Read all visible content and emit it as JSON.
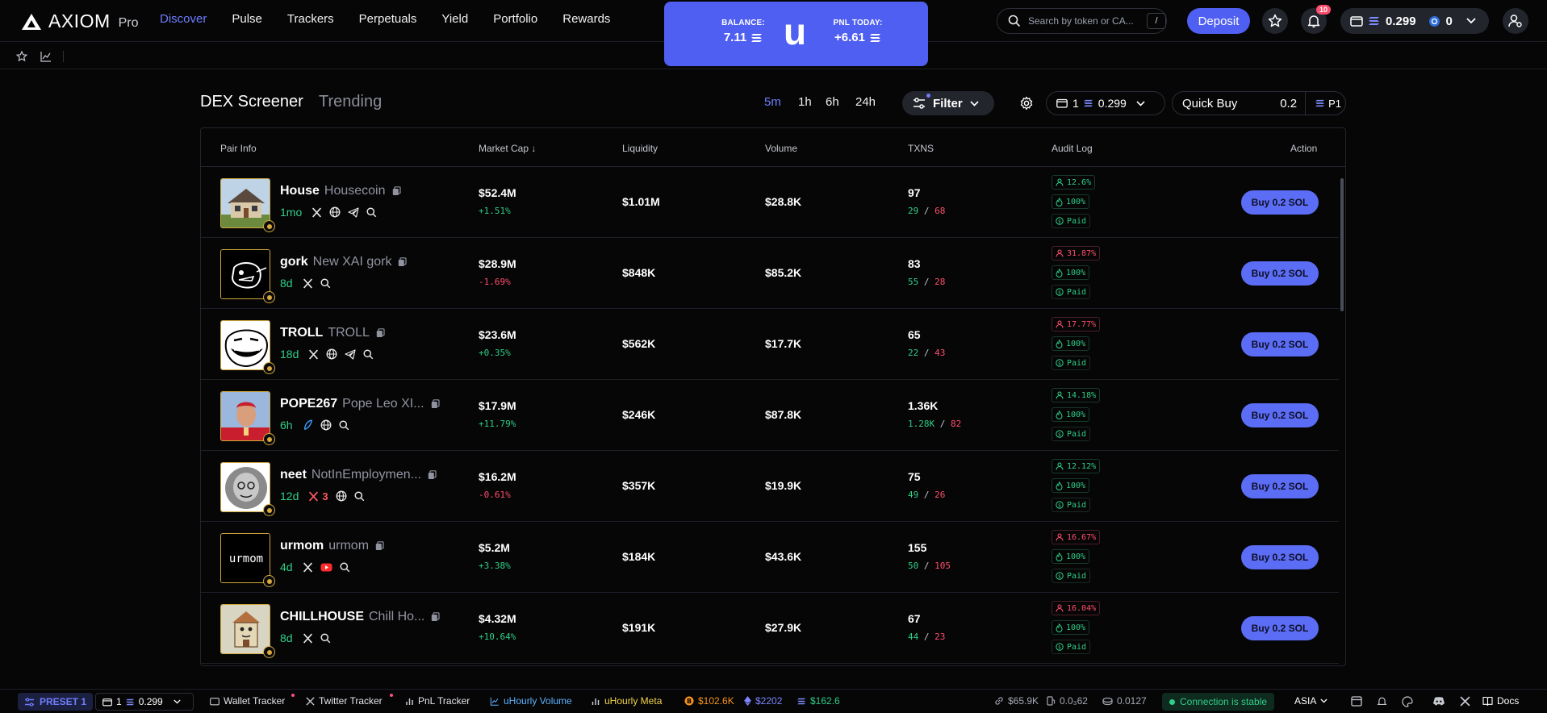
{
  "app": {
    "logo_text": "AXIOM",
    "logo_pro": "Pro",
    "nav": [
      "Discover",
      "Pulse",
      "Trackers",
      "Perpetuals",
      "Yield",
      "Portfolio",
      "Rewards"
    ],
    "active_nav": "Discover"
  },
  "balance_card": {
    "balance_label": "BALANCE:",
    "balance_value": "7.11",
    "letter": "u",
    "pnl_label": "PNL TODAY:",
    "pnl_value": "+6.61"
  },
  "header": {
    "search_placeholder": "Search by token or CA...",
    "search_shortcut": "/",
    "deposit_label": "Deposit",
    "notifications_count": "10",
    "wallet_sol": "0.299",
    "wallet_count": "0"
  },
  "screener": {
    "title": "DEX Screener",
    "alt_tab": "Trending",
    "timeframes": [
      "5m",
      "1h",
      "6h",
      "24h"
    ],
    "active_timeframe": "5m",
    "filter_label": "Filter",
    "wallet_count": "1",
    "wallet_sol": "0.299",
    "quick_buy_label": "Quick Buy",
    "quick_buy_value": "0.2",
    "preset_label": "P1"
  },
  "table": {
    "columns": [
      "Pair Info",
      "Market Cap ↓",
      "Liquidity",
      "Volume",
      "TXNS",
      "Audit Log",
      "Action"
    ],
    "buy_label": "Buy 0.2 SOL",
    "rows": [
      {
        "symbol": "House",
        "name": "Housecoin",
        "age": "1mo",
        "socials": [
          "x-icon",
          "globe-icon",
          "telegram-icon",
          "search-icon"
        ],
        "x_count": "",
        "market_cap": "$52.4M",
        "mc_change": "+1.51%",
        "mc_up": true,
        "liquidity": "$1.01M",
        "volume": "$28.8K",
        "txns": "97",
        "buys": "29",
        "sells": "68",
        "holders_pct": "12.6%",
        "holders_red": false,
        "lp_burn": "100%",
        "paid": "Paid",
        "avatar": "house"
      },
      {
        "symbol": "gork",
        "name": "New XAI gork",
        "age": "8d",
        "socials": [
          "x-icon",
          "search-icon"
        ],
        "x_count": "",
        "market_cap": "$28.9M",
        "mc_change": "-1.69%",
        "mc_up": false,
        "liquidity": "$848K",
        "volume": "$85.2K",
        "txns": "83",
        "buys": "55",
        "sells": "28",
        "holders_pct": "31.87%",
        "holders_red": true,
        "lp_burn": "100%",
        "paid": "Paid",
        "avatar": "gork"
      },
      {
        "symbol": "TROLL",
        "name": "TROLL",
        "age": "18d",
        "socials": [
          "x-icon",
          "globe-icon",
          "telegram-icon",
          "search-icon"
        ],
        "x_count": "",
        "market_cap": "$23.6M",
        "mc_change": "+0.35%",
        "mc_up": true,
        "liquidity": "$562K",
        "volume": "$17.7K",
        "txns": "65",
        "buys": "22",
        "sells": "43",
        "holders_pct": "17.77%",
        "holders_red": true,
        "lp_burn": "100%",
        "paid": "Paid",
        "avatar": "troll"
      },
      {
        "symbol": "POPE267",
        "name": "Pope Leo XI...",
        "age": "6h",
        "socials": [
          "feather-icon",
          "globe-icon",
          "search-icon"
        ],
        "x_count": "",
        "market_cap": "$17.9M",
        "mc_change": "+11.79%",
        "mc_up": true,
        "liquidity": "$246K",
        "volume": "$87.8K",
        "txns": "1.36K",
        "buys": "1.28K",
        "sells": "82",
        "holders_pct": "14.18%",
        "holders_red": false,
        "lp_burn": "100%",
        "paid": "Paid",
        "avatar": "pope"
      },
      {
        "symbol": "neet",
        "name": "NotInEmploymen...",
        "age": "12d",
        "socials": [
          "x-red-icon",
          "globe-icon",
          "search-icon"
        ],
        "x_count": "3",
        "market_cap": "$16.2M",
        "mc_change": "-0.61%",
        "mc_up": false,
        "liquidity": "$357K",
        "volume": "$19.9K",
        "txns": "75",
        "buys": "49",
        "sells": "26",
        "holders_pct": "12.12%",
        "holders_red": false,
        "lp_burn": "100%",
        "paid": "Paid",
        "avatar": "neet"
      },
      {
        "symbol": "urmom",
        "name": "urmom",
        "age": "4d",
        "socials": [
          "x-icon",
          "youtube-icon",
          "search-icon"
        ],
        "x_count": "",
        "market_cap": "$5.2M",
        "mc_change": "+3.38%",
        "mc_up": true,
        "liquidity": "$184K",
        "volume": "$43.6K",
        "txns": "155",
        "buys": "50",
        "sells": "105",
        "holders_pct": "16.67%",
        "holders_red": true,
        "lp_burn": "100%",
        "paid": "Paid",
        "avatar": "urmom",
        "avatar_text": "urmom"
      },
      {
        "symbol": "CHILLHOUSE",
        "name": "Chill Ho...",
        "age": "8d",
        "socials": [
          "x-icon",
          "search-icon"
        ],
        "x_count": "",
        "market_cap": "$4.32M",
        "mc_change": "+10.64%",
        "mc_up": true,
        "liquidity": "$191K",
        "volume": "$27.9K",
        "txns": "67",
        "buys": "44",
        "sells": "23",
        "holders_pct": "16.04%",
        "holders_red": true,
        "lp_burn": "100%",
        "paid": "Paid",
        "avatar": "chill"
      }
    ]
  },
  "footer": {
    "preset": "PRESET 1",
    "wallet_count": "1",
    "wallet_sol": "0.299",
    "wallet_tracker": "Wallet Tracker",
    "twitter_tracker": "Twitter Tracker",
    "pnl_tracker": "PnL Tracker",
    "hourly_volume": "uHourly Volume",
    "hourly_meta": "uHourly Meta",
    "btc_price": "$102.6K",
    "eth_price": "$2202",
    "sol_price": "$162.6",
    "stat1": "$65.9K",
    "stat2": "0.0₃62",
    "stat3": "0.0127",
    "connection": "Connection is stable",
    "region": "ASIA",
    "docs": "Docs"
  },
  "colors": {
    "accent": "#4f5ff1",
    "positive": "#2fcf88",
    "negative": "#ff4f6b",
    "avatar_border": "#d1a93a"
  }
}
